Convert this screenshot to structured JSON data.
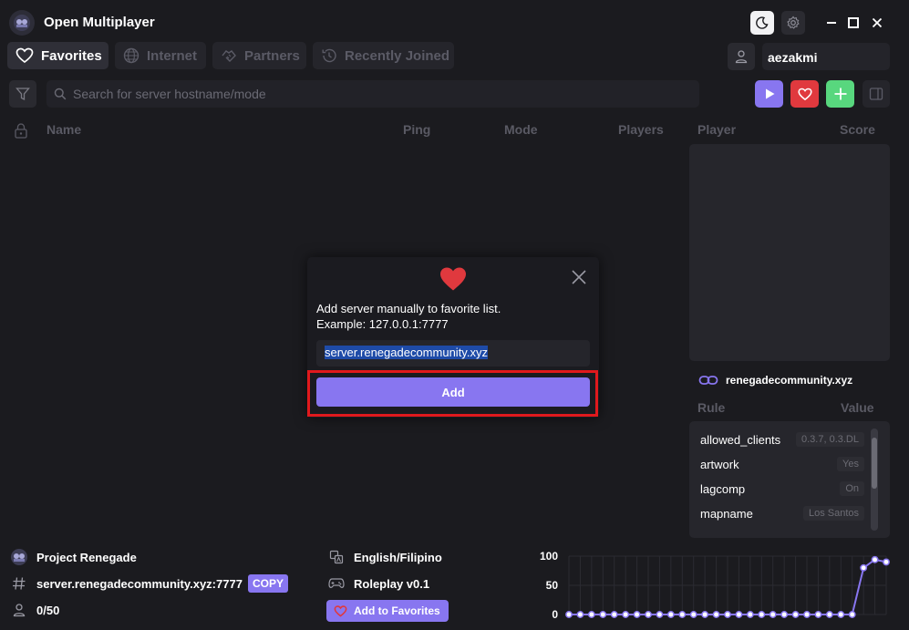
{
  "app": {
    "title": "Open Multiplayer"
  },
  "tabs": [
    {
      "label": "Favorites",
      "icon": "heart-icon",
      "active": true
    },
    {
      "label": "Internet",
      "icon": "globe-icon",
      "active": false
    },
    {
      "label": "Partners",
      "icon": "handshake-icon",
      "active": false
    },
    {
      "label": "Recently Joined",
      "icon": "history-icon",
      "active": false
    }
  ],
  "user": {
    "name": "aezakmi"
  },
  "search": {
    "placeholder": "Search for server hostname/mode"
  },
  "table": {
    "columns": [
      "Name",
      "Ping",
      "Mode",
      "Players"
    ]
  },
  "players_panel": {
    "columns": [
      "Player",
      "Score"
    ]
  },
  "server_link": "renegadecommunity.xyz",
  "rules": {
    "columns": [
      "Rule",
      "Value"
    ],
    "rows": [
      {
        "name": "allowed_clients",
        "value": "0.3.7, 0.3.DL"
      },
      {
        "name": "artwork",
        "value": "Yes"
      },
      {
        "name": "lagcomp",
        "value": "On"
      },
      {
        "name": "mapname",
        "value": "Los Santos"
      }
    ]
  },
  "modal": {
    "line1": "Add server manually to favorite list.",
    "line2": "Example: 127.0.0.1:7777",
    "input_value": "server.renegadecommunity.xyz",
    "add_label": "Add"
  },
  "server_info": {
    "name": "Project Renegade",
    "address": "server.renegadecommunity.xyz:7777",
    "copy_label": "COPY",
    "players": "0/50",
    "language": "English/Filipino",
    "mode": "Roleplay v0.1",
    "favorite_label": "Add to Favorites"
  },
  "colors": {
    "accent": "#8876f0",
    "danger": "#e0191d",
    "play": "#8876f0",
    "favorite": "#e0393e",
    "add": "#58d77e"
  },
  "chart_data": {
    "type": "line",
    "yticks": [
      "100",
      "50",
      "0"
    ],
    "ylim": [
      0,
      100
    ],
    "values": [
      0,
      0,
      0,
      0,
      0,
      0,
      0,
      0,
      0,
      0,
      0,
      0,
      0,
      0,
      0,
      0,
      0,
      0,
      0,
      0,
      0,
      0,
      0,
      0,
      0,
      0,
      80,
      94,
      90
    ]
  }
}
